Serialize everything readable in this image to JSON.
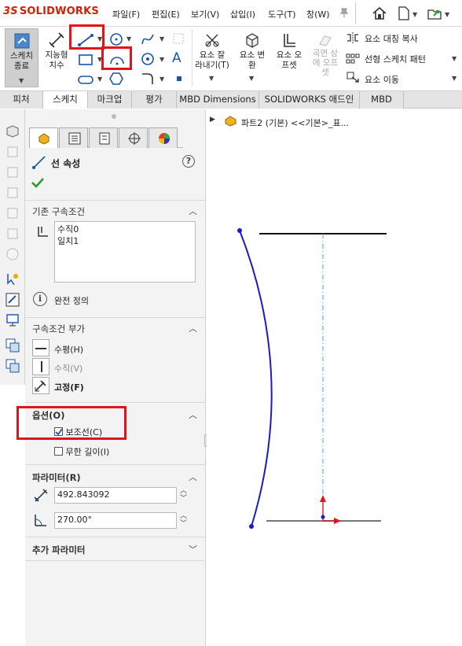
{
  "app": {
    "brand": "SOLIDWORKS"
  },
  "menu": [
    "파일(F)",
    "편집(E)",
    "보기(V)",
    "삽입(I)",
    "도구(T)",
    "창(W)"
  ],
  "ribbon": {
    "exit_sketch": "스케치\n종료",
    "smart_dimension": "지능형\n치수",
    "trim": "요소 잘\n라내기(T)",
    "convert": "요소 변\n환",
    "offset": "요소 오\n프셋",
    "surface_offset": "곡면 상\n에 오프\n셋",
    "mirror": "요소 대칭 복사",
    "linear_pattern": "선형 스케치 패턴",
    "move": "요소 이동"
  },
  "tabs": [
    "피처",
    "스케치",
    "마크업",
    "평가",
    "MBD Dimensions",
    "SOLIDWORKS 애드인",
    "MBD"
  ],
  "active_tab": "스케치",
  "pm": {
    "title": "선 속성",
    "existing_relations": "기존 구속조건",
    "relations": [
      "수직0",
      "일치1"
    ],
    "fully_defined": "완전 정의",
    "add_relations": "구속조건 부가",
    "add": [
      "수평(H)",
      "수직(V)",
      "고정(F)"
    ],
    "options": "옵션(O)",
    "construction": "보조선(C)",
    "construction_checked": true,
    "infinite": "무한 길이(I)",
    "infinite_checked": false,
    "parameters": "파라미터(R)",
    "length": "492.843092",
    "angle": "270.00°",
    "additional": "추가 파라미터"
  },
  "tree": {
    "part": "파트2 (기본) <<기본>_표..."
  },
  "colors": {
    "accent": "#e3121b",
    "sketch_blue": "#1a1acc",
    "construction": "#4aa3df"
  }
}
